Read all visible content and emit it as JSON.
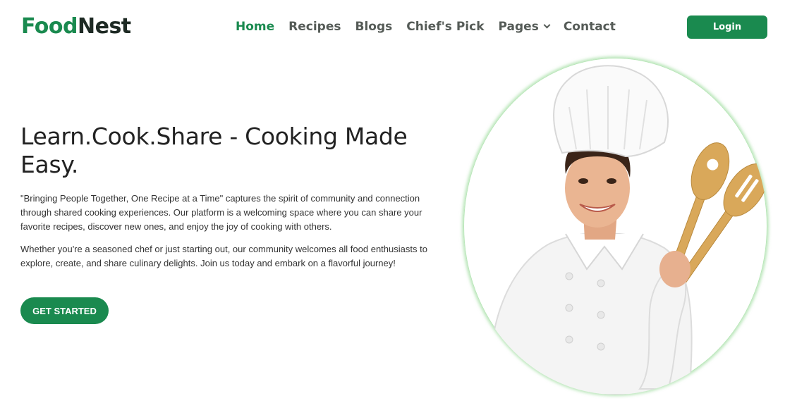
{
  "brand": {
    "part1": "Food",
    "part2": "Nest"
  },
  "nav": {
    "items": [
      {
        "label": "Home",
        "active": true
      },
      {
        "label": "Recipes"
      },
      {
        "label": "Blogs"
      },
      {
        "label": "Chief's Pick"
      },
      {
        "label": "Pages",
        "dropdown": true
      },
      {
        "label": "Contact"
      }
    ],
    "dropdown_icon": "chevron-down-icon"
  },
  "login_label": "Login",
  "hero": {
    "title": "Learn.Cook.Share - Cooking Made Easy.",
    "paragraph1": "\"Bringing People Together, One Recipe at a Time\" captures the spirit of community and connection through shared cooking experiences. Our platform is a welcoming space where you can share your favorite recipes, discover new ones, and enjoy the joy of cooking with others.",
    "paragraph2": "Whether you're a seasoned chef or just starting out, our community welcomes all food enthusiasts to explore, create, and share culinary delights. Join us today and embark on a flavorful journey!",
    "cta_label": "GET STARTED",
    "image": "chef-woman-with-wooden-spoons"
  },
  "colors": {
    "accent": "#1a8a4f",
    "brand_dark": "#1e2a24",
    "nav_text": "#555b57",
    "image_ring": "#9fdc9f"
  }
}
